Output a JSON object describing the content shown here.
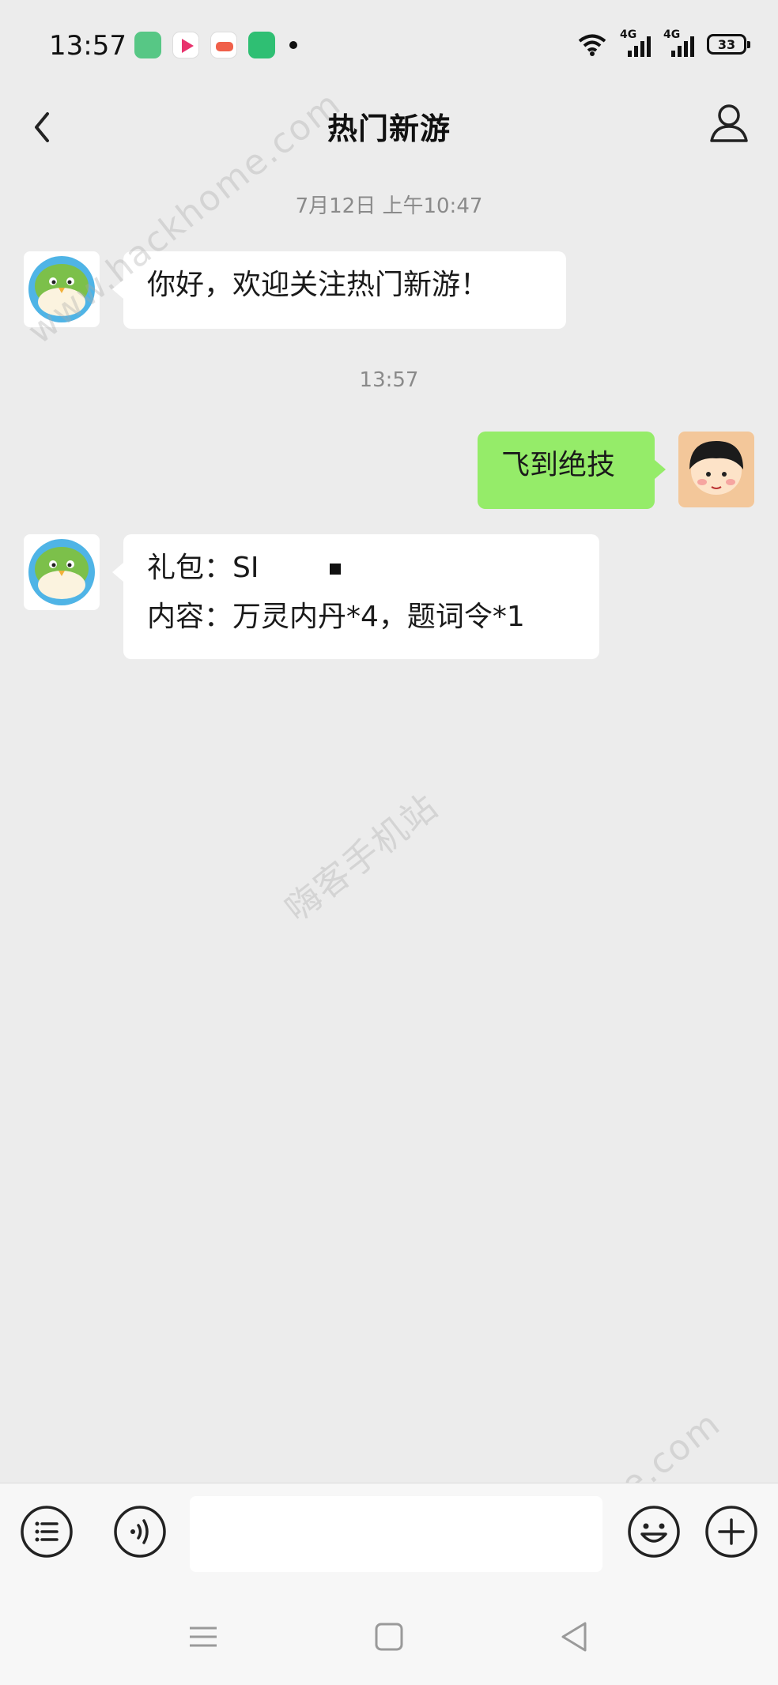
{
  "status_bar": {
    "time": "13:57",
    "network_1": "4G",
    "network_2": "4G",
    "battery": "33",
    "app_icons": [
      "messages-app-icon",
      "video-app-icon",
      "game-app-icon",
      "phone-app-icon"
    ]
  },
  "header": {
    "title": "热门新游",
    "back_icon": "chevron-left-icon",
    "profile_icon": "person-icon"
  },
  "messages": [
    {
      "type": "timestamp",
      "text": "7月12日 上午10:47"
    },
    {
      "type": "incoming",
      "text": "你好，欢迎关注热门新游！"
    },
    {
      "type": "timestamp",
      "text": "13:57"
    },
    {
      "type": "outgoing",
      "text": "飞到绝技"
    },
    {
      "type": "incoming",
      "line1": "礼包：SI",
      "line2": "内容：万灵内丹*4，题词令*1"
    }
  ],
  "input_bar": {
    "menu_icon": "list-menu-icon",
    "voice_icon": "voice-icon",
    "emoji_icon": "emoji-icon",
    "plus_icon": "plus-icon",
    "input_value": ""
  },
  "nav_bar": {
    "icons": [
      "menu-nav-icon",
      "home-nav-icon",
      "back-nav-icon"
    ]
  },
  "watermarks": [
    "www.hackhome.com",
    "嗨客手机站",
    "www.hackhome.com"
  ],
  "colors": {
    "background": "#ececec",
    "outgoing_bubble": "#95ec69",
    "incoming_bubble": "#ffffff",
    "timestamp": "#8a8a8a"
  }
}
